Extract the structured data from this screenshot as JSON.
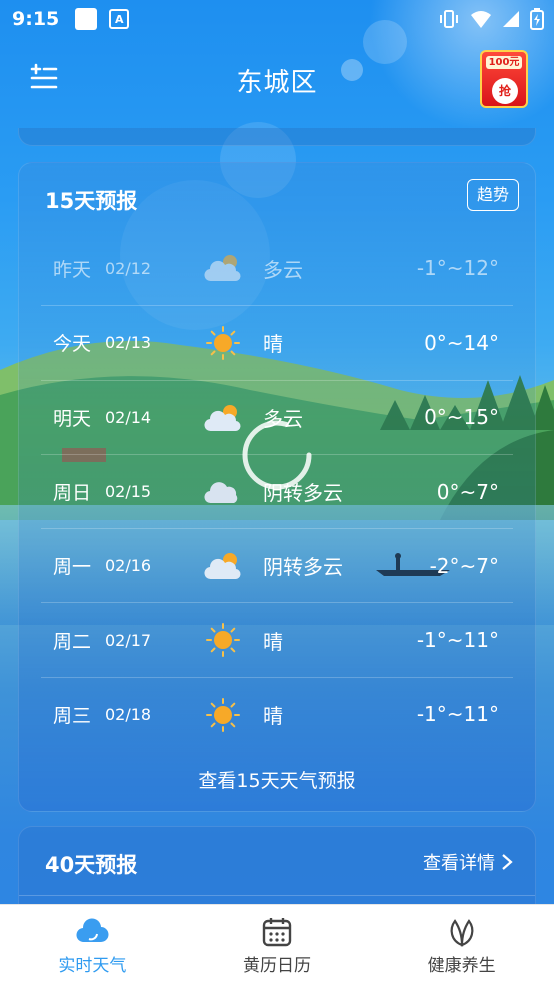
{
  "status_bar": {
    "time": "9:15"
  },
  "header": {
    "city": "东城区",
    "promo_amount": "100元",
    "promo_coin": "抢"
  },
  "forecast15": {
    "title": "15天预报",
    "trend_label": "趋势",
    "view_more_label": "查看15天天气预报",
    "days": [
      {
        "day": "昨天",
        "date": "02/12",
        "condition": "多云",
        "temp": "-1°~12°",
        "icon": "partly-cloudy-icon",
        "past": true
      },
      {
        "day": "今天",
        "date": "02/13",
        "condition": "晴",
        "temp": "0°~14°",
        "icon": "sun-icon",
        "past": false
      },
      {
        "day": "明天",
        "date": "02/14",
        "condition": "多云",
        "temp": "0°~15°",
        "icon": "partly-cloudy-icon",
        "past": false
      },
      {
        "day": "周日",
        "date": "02/15",
        "condition": "阴转多云",
        "temp": "0°~7°",
        "icon": "cloud-icon",
        "past": false
      },
      {
        "day": "周一",
        "date": "02/16",
        "condition": "阴转多云",
        "temp": "-2°~7°",
        "icon": "partly-cloudy-icon",
        "past": false
      },
      {
        "day": "周二",
        "date": "02/17",
        "condition": "晴",
        "temp": "-1°~11°",
        "icon": "sun-icon",
        "past": false
      },
      {
        "day": "周三",
        "date": "02/18",
        "condition": "晴",
        "temp": "-1°~11°",
        "icon": "sun-icon",
        "past": false
      }
    ]
  },
  "forecast40": {
    "title": "40天预报",
    "detail_label": "查看详情"
  },
  "tabs": [
    {
      "label": "实时天气",
      "icon": "cloud-tab-icon",
      "active": true
    },
    {
      "label": "黄历日历",
      "icon": "calendar-icon",
      "active": false
    },
    {
      "label": "健康养生",
      "icon": "leaf-icon",
      "active": false
    }
  ],
  "colors": {
    "accent": "#2f9bf0",
    "sun": "#f7a928"
  }
}
